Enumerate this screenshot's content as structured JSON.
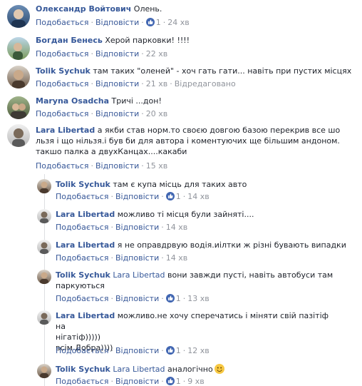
{
  "actions": {
    "like": "Подобається",
    "reply": "Відповісти",
    "edited": "Відредаговано"
  },
  "comments": [
    {
      "name": "Олександр Войтович",
      "text": "Олень.",
      "likes": "1",
      "time": "24 хв"
    },
    {
      "name": "Богдан Бенесь",
      "text": "Херой парковки! !!!!",
      "time": "22 хв"
    },
    {
      "name": "Tolik Sychuk",
      "text": "там таких \"оленей\" - хоч гать гати... навіть при пустих місцях",
      "time": "21 хв"
    },
    {
      "name": "Maryna Osadcha",
      "text": "Тричі ...дон!",
      "time": "20 хв"
    },
    {
      "name": "Lara Libertad",
      "text1": "а якби став норм.то своєю довгою базою перекрив все шо",
      "text2": "льзя і що нільзя.і був би для автора і коментуючих ще більшим андоном.",
      "text3": "такшо палка а двухКанцах....какаби",
      "time": "15 хв"
    }
  ],
  "replies": [
    {
      "name": "Tolik Sychuk",
      "text": "там є купа місць для таких авто",
      "likes": "1",
      "time": "14 хв"
    },
    {
      "name": "Lara Libertad",
      "text": "можливо ті місця були зайняті....",
      "time": "14 хв"
    },
    {
      "name": "Lara Libertad",
      "text": "я не оправдрвую водія.иілтки ж різні бувають випадки",
      "time": "14 хв"
    },
    {
      "name": "Tolik Sychuk",
      "mention": "Lara Libertad",
      "text1": "вони завжди пусті, навіть автобуси там",
      "text2": "паркуються",
      "likes": "1",
      "time": "13 хв"
    },
    {
      "name": "Lara Libertad",
      "text1": "можливо.не хочу сперечатись і міняти свій пазітіф на",
      "text2": "нігатіф)))))",
      "text3": "всім Добра))))",
      "likes": "1",
      "time": "12 хв"
    },
    {
      "name": "Tolik Sychuk",
      "mention": "Lara Libertad",
      "text": "аналогічно",
      "likes": "1",
      "time": "9 хв"
    }
  ]
}
